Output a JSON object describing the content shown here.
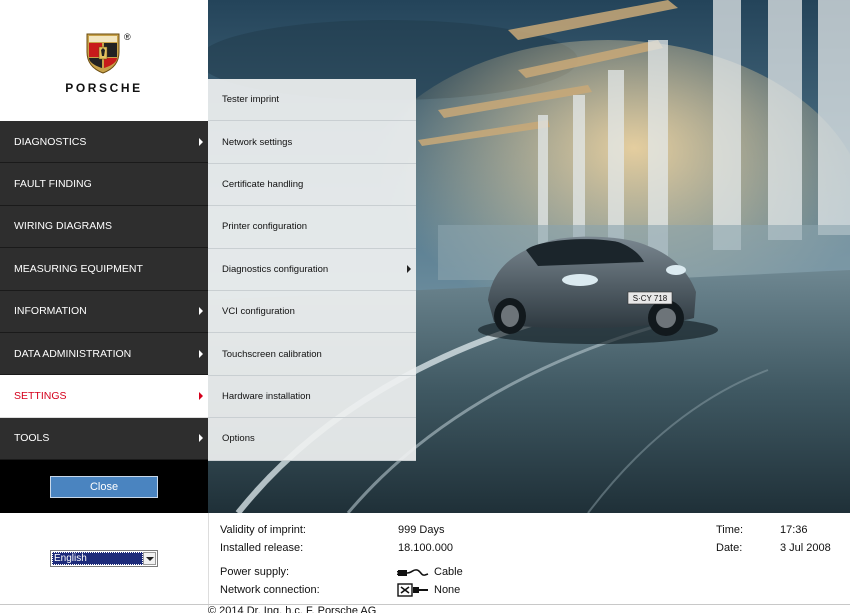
{
  "brand": {
    "name": "PORSCHE",
    "registered": "®"
  },
  "main_menu": [
    {
      "label": "DIAGNOSTICS",
      "has_submenu": true,
      "active": false
    },
    {
      "label": "FAULT FINDING",
      "has_submenu": false,
      "active": false
    },
    {
      "label": "WIRING DIAGRAMS",
      "has_submenu": false,
      "active": false
    },
    {
      "label": "MEASURING EQUIPMENT",
      "has_submenu": false,
      "active": false
    },
    {
      "label": "INFORMATION",
      "has_submenu": true,
      "active": false
    },
    {
      "label": "DATA ADMINISTRATION",
      "has_submenu": true,
      "active": false
    },
    {
      "label": "SETTINGS",
      "has_submenu": true,
      "active": true
    },
    {
      "label": "TOOLS",
      "has_submenu": true,
      "active": false
    }
  ],
  "settings_submenu": [
    {
      "label": "Tester imprint",
      "has_submenu": false
    },
    {
      "label": "Network settings",
      "has_submenu": false
    },
    {
      "label": "Certificate handling",
      "has_submenu": false
    },
    {
      "label": "Printer configuration",
      "has_submenu": false
    },
    {
      "label": "Diagnostics configuration",
      "has_submenu": true
    },
    {
      "label": "VCI configuration",
      "has_submenu": false
    },
    {
      "label": "Touchscreen calibration",
      "has_submenu": false
    },
    {
      "label": "Hardware installation",
      "has_submenu": false
    },
    {
      "label": "Options",
      "has_submenu": false
    }
  ],
  "close_label": "Close",
  "language": {
    "selected": "English"
  },
  "status": {
    "validity_label": "Validity of imprint:",
    "validity_value": "999 Days",
    "release_label": "Installed release:",
    "release_value": "18.100.000",
    "power_label": "Power supply:",
    "power_value": "Cable",
    "power_icon": "cable-plug-icon",
    "network_label": "Network connection:",
    "network_value": "None",
    "network_icon": "network-disconnected-icon",
    "time_label": "Time:",
    "time_value": "17:36",
    "date_label": "Date:",
    "date_value": "3 Jul 2008"
  },
  "copyright": "© 2014 Dr. Ing. h.c. F. Porsche AG",
  "hero": {
    "license_plate": "S·CY 718"
  },
  "colors": {
    "accent_red": "#d5001c",
    "menu_dark": "#2e2e2e",
    "close_button": "#4a84c0",
    "language_highlight": "#1d2b7a"
  }
}
